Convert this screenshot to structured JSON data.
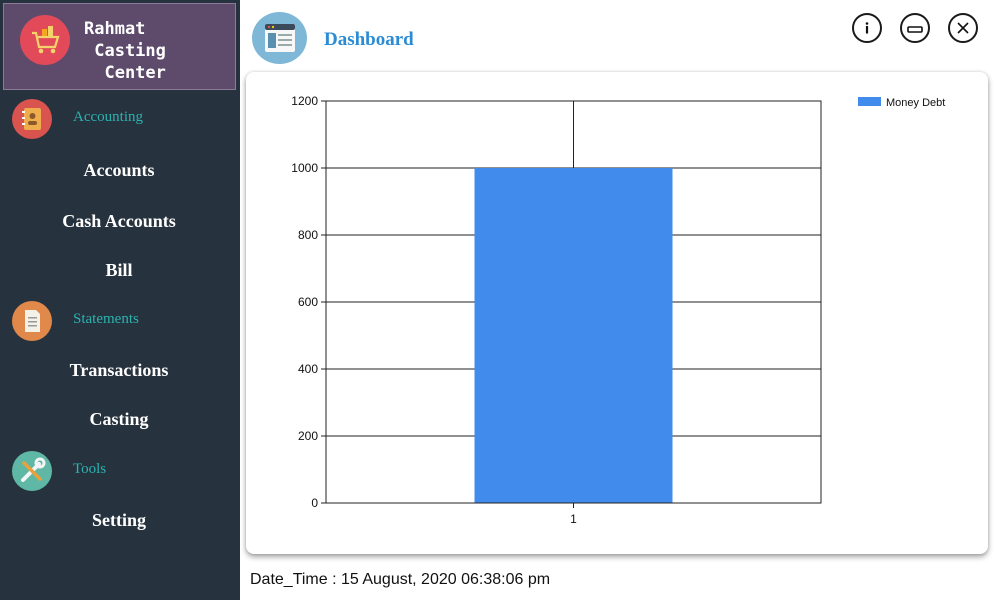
{
  "app": {
    "title_lines": "Rahmat\n Casting\n  Center"
  },
  "sidebar": {
    "sections": [
      {
        "label": "Accounting",
        "icon": "address-book-icon"
      },
      {
        "label": "Statements",
        "icon": "document-icon"
      },
      {
        "label": "Tools",
        "icon": "wrench-screwdriver-icon"
      }
    ],
    "items": [
      {
        "label": "Accounts"
      },
      {
        "label": "Cash Accounts"
      },
      {
        "label": "Bill"
      },
      {
        "label": "Transactions"
      },
      {
        "label": "Casting"
      },
      {
        "label": "Setting"
      }
    ]
  },
  "header": {
    "title": "Dashboard",
    "icon": "browser-window-icon",
    "buttons": [
      "info-icon",
      "minimize-icon",
      "close-icon"
    ]
  },
  "colors": {
    "sidebar_bg": "#26323d",
    "brand_bg": "#5e4a6b",
    "section_text": "#2bb3b0",
    "header_title": "#2b8bd3",
    "bar": "#418bed"
  },
  "chart_data": {
    "type": "bar",
    "categories": [
      "1"
    ],
    "series": [
      {
        "name": "Money Debt",
        "values": [
          1000
        ]
      }
    ],
    "ylim": [
      0,
      1200
    ],
    "yticks": [
      0,
      200,
      400,
      600,
      800,
      1000,
      1200
    ],
    "grid": true,
    "legend": "top-right"
  },
  "footer": {
    "datetime": "Date_Time : 15 August, 2020 06:38:06 pm"
  }
}
